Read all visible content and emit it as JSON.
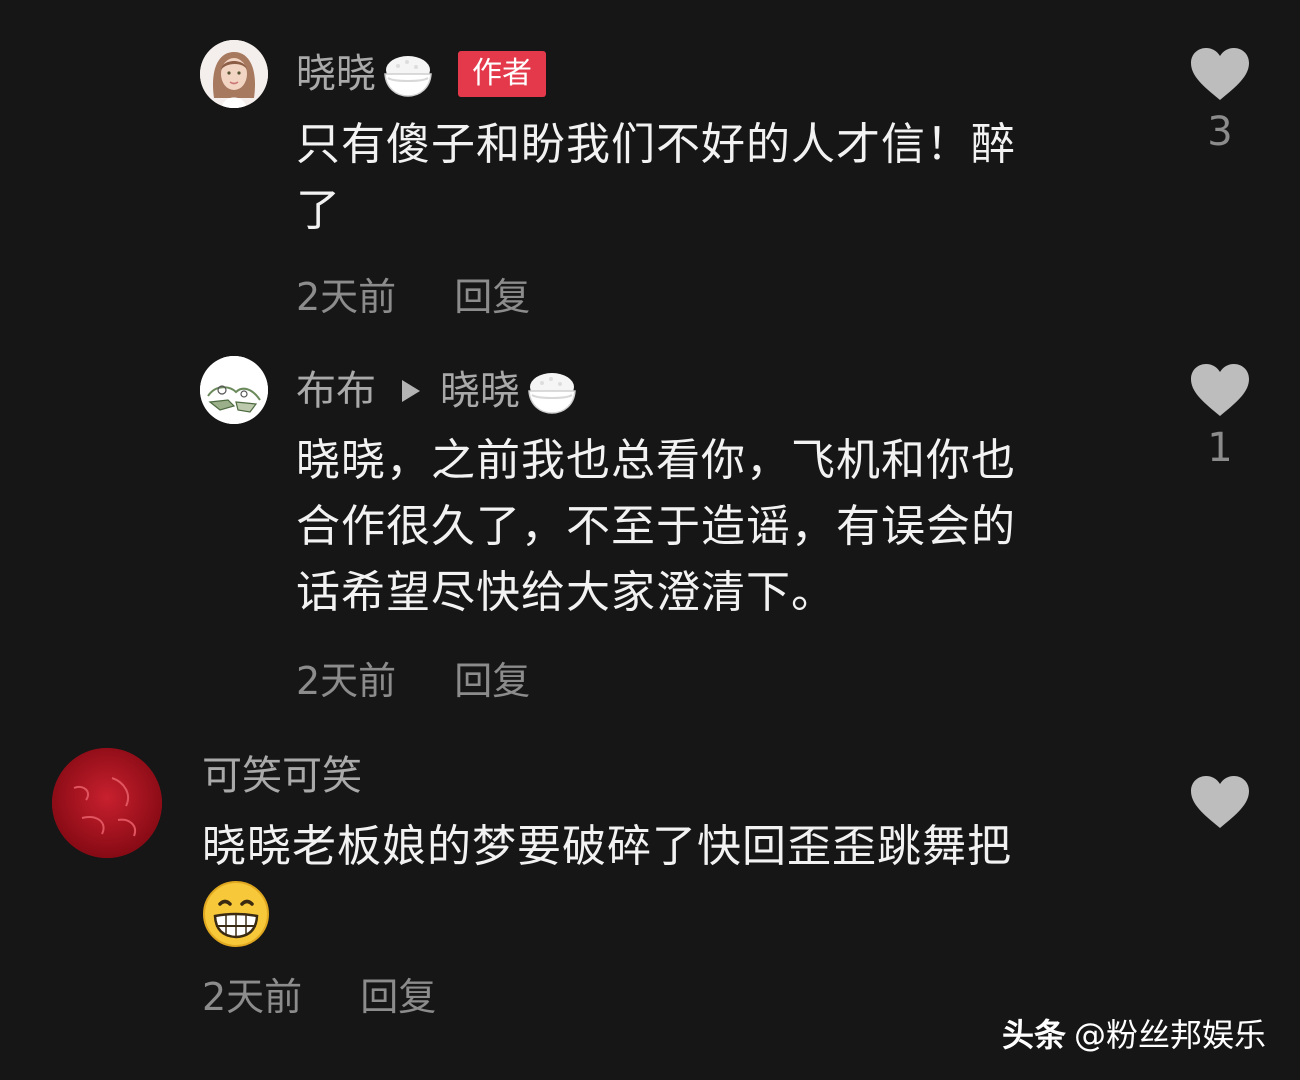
{
  "comments": [
    {
      "username": "晓晓",
      "badge": "作者",
      "text_line1": "只有傻子和盼我们不好的人才信！醉",
      "text_line2": "了",
      "time": "2天前",
      "reply_label": "回复",
      "like_count": "3",
      "avatar_icon": "woman-portrait-avatar",
      "name_icon": "rice-bowl-icon"
    },
    {
      "username": "布布",
      "reply_to": "晓晓",
      "text_line1": "晓晓，之前我也总看你，飞机和你也",
      "text_line2": "合作很久了，不至于造谣，有误会的",
      "text_line3": "话希望尽快给大家澄清下。",
      "time": "2天前",
      "reply_label": "回复",
      "like_count": "1",
      "avatar_icon": "sketch-avatar",
      "name_icon": "rice-bowl-icon"
    },
    {
      "username": "可笑可笑",
      "text_line1": "晓晓老板娘的梦要破碎了快回歪歪跳舞把",
      "time": "2天前",
      "reply_label": "回复",
      "avatar_icon": "red-fu-avatar",
      "emoji": "grinning-face-emoji"
    }
  ],
  "watermark": {
    "brand": "头条",
    "account": "@粉丝邦娱乐"
  },
  "colors": {
    "background": "#161616",
    "badge": "#e3394b",
    "username": "#a9a9a9",
    "meta": "#8c8c8c",
    "heart": "#bdbdbd"
  }
}
